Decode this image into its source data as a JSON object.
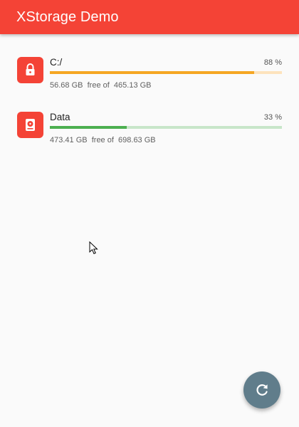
{
  "app": {
    "title": "XStorage Demo"
  },
  "drives": [
    {
      "name": "C:/",
      "icon": "lock-icon",
      "percent_label": "88 %",
      "used_fraction": 0.88,
      "free": "56.68 GB",
      "free_of_text": "free of",
      "total": "465.13 GB",
      "bar_color": "#f5a623",
      "track_color": "#fde3bd"
    },
    {
      "name": "Data",
      "icon": "hard-drive-icon",
      "percent_label": "33 %",
      "used_fraction": 0.33,
      "free": "473.41 GB",
      "free_of_text": "free of",
      "total": "698.63 GB",
      "bar_color": "#4caf50",
      "track_color": "#c8e6c9"
    }
  ],
  "fab": {
    "icon": "refresh-icon",
    "color": "#607d8b"
  },
  "colors": {
    "appbar": "#f44336",
    "background": "#fafafa"
  }
}
